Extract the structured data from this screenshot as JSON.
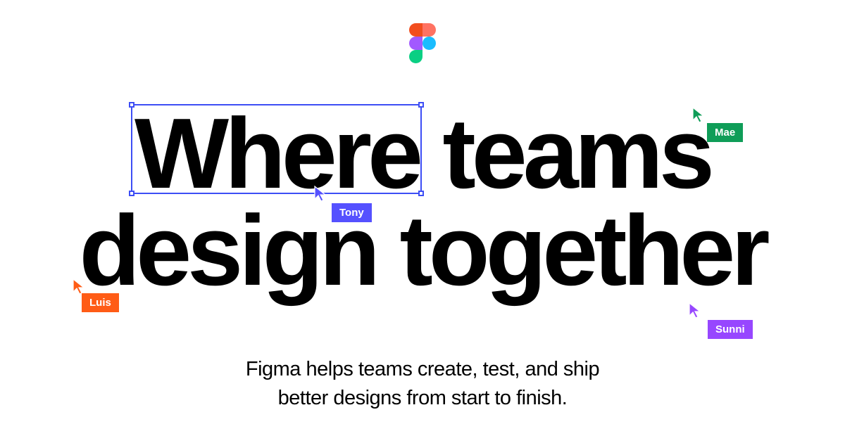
{
  "logo_name": "figma-logo",
  "headline": {
    "word1": "Where",
    "word2": "teams",
    "word3": "design together"
  },
  "subhead": {
    "line1": "Figma helps teams create, test, and ship",
    "line2": "better designs from start to finish."
  },
  "cursors": {
    "tony": {
      "name": "Tony",
      "color": "#5551ff"
    },
    "mae": {
      "name": "Mae",
      "color": "#0f9d58"
    },
    "luis": {
      "name": "Luis",
      "color": "#ff5c16"
    },
    "sunni": {
      "name": "Sunni",
      "color": "#9747ff"
    }
  },
  "selection_color": "#3d4ef5"
}
